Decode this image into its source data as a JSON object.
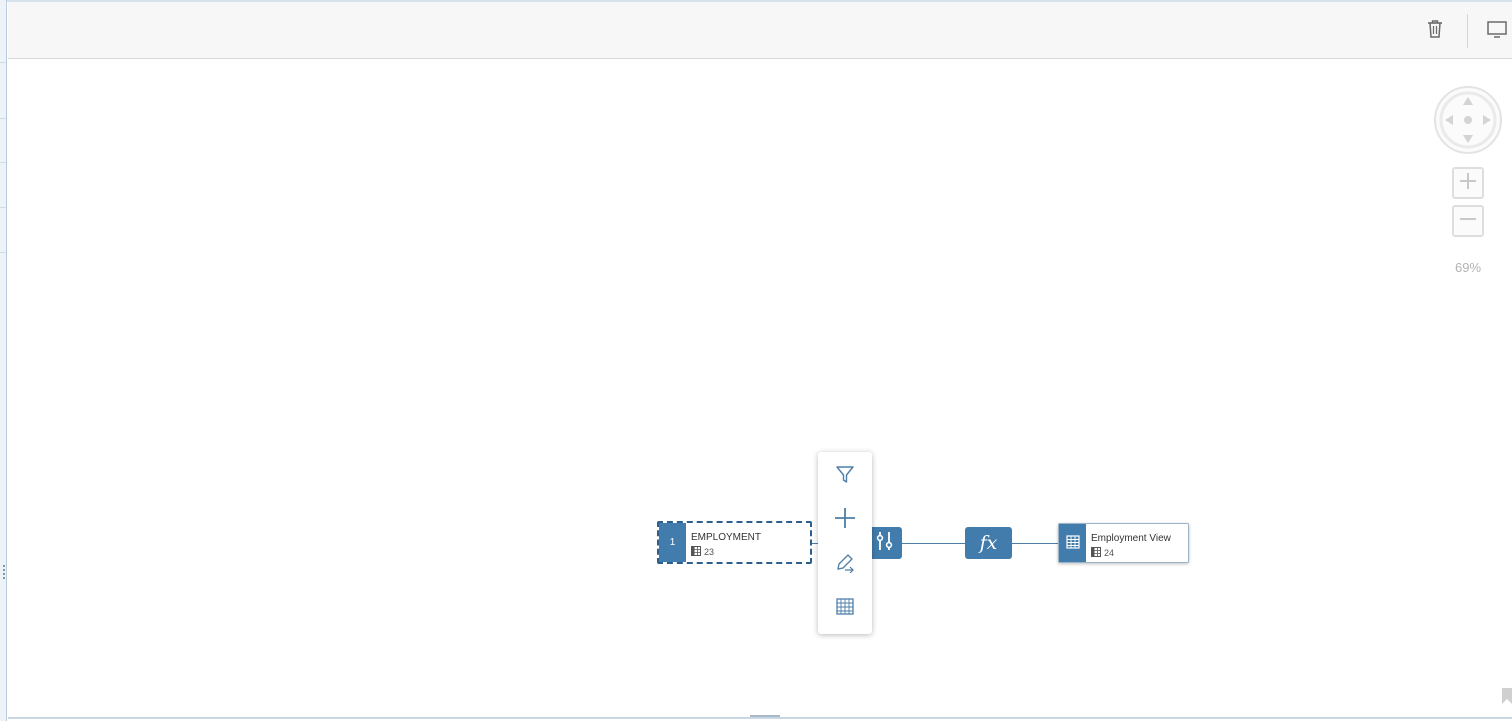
{
  "toolbar": {
    "delete_icon": "trash-icon",
    "display_icon": "monitor-icon"
  },
  "navigation": {
    "pan_icon": "pan-arrows-icon",
    "zoom_in_icon": "plus-icon",
    "zoom_out_icon": "minus-icon",
    "zoom_level": "69%"
  },
  "flow": {
    "source": {
      "index": "1",
      "title": "EMPLOYMENT",
      "count": "23",
      "icon": "table-icon"
    },
    "projection": {
      "icon": "sliders-icon"
    },
    "calculation": {
      "label": "fx"
    },
    "output": {
      "title": "Employment View",
      "count": "24",
      "icon": "view-icon"
    }
  },
  "context_menu": {
    "items": [
      {
        "icon": "filter-icon"
      },
      {
        "icon": "plus-icon"
      },
      {
        "icon": "edit-arrow-icon"
      },
      {
        "icon": "grid-table-icon"
      }
    ]
  },
  "colors": {
    "node_accent": "#427cac",
    "link": "#4d7ea8",
    "toolbar_bg": "#f7f7f7"
  }
}
